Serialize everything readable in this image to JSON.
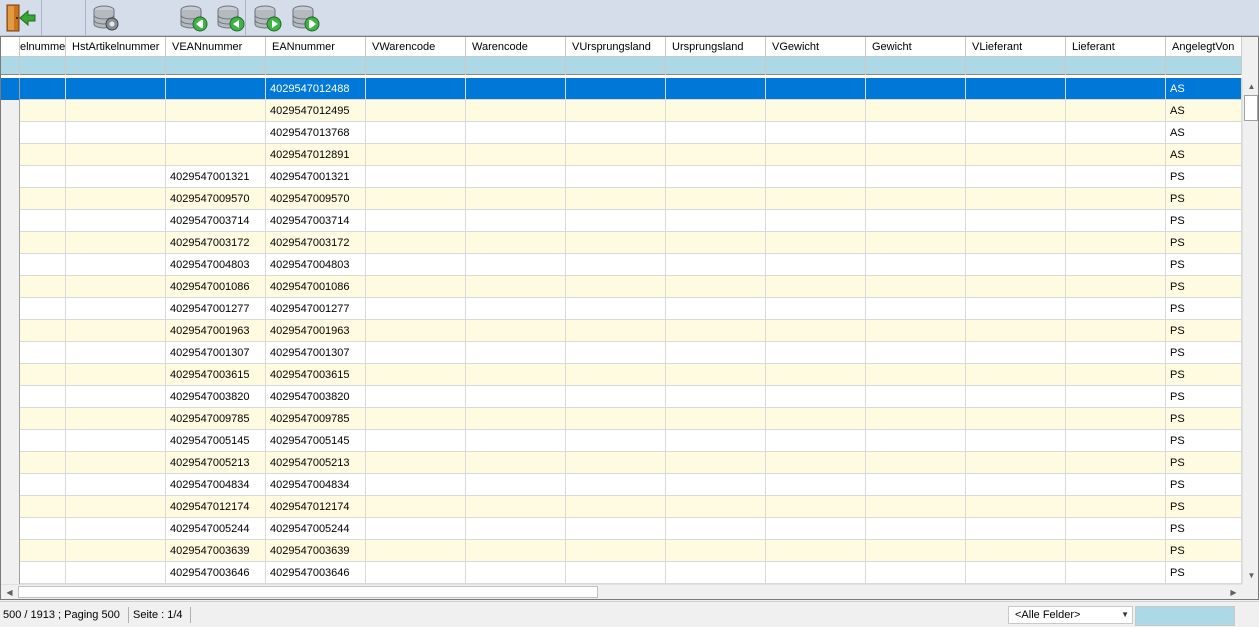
{
  "toolbar": {
    "buttons": [
      {
        "name": "exit-door-icon"
      },
      {
        "name": "database-settings-icon"
      },
      {
        "name": "database-first-icon"
      },
      {
        "name": "database-previous-icon"
      },
      {
        "name": "database-next-icon"
      },
      {
        "name": "database-last-icon"
      }
    ]
  },
  "grid": {
    "columns": [
      "elnummer",
      "HstArtikelnummer",
      "VEANnummer",
      "EANnummer",
      "VWarencode",
      "Warencode",
      "VUrsprungsland",
      "Ursprungsland",
      "VGewicht",
      "Gewicht",
      "VLieferant",
      "Lieferant",
      "AngelegtVon"
    ],
    "rows": [
      [
        "",
        "",
        "",
        "4029547012488",
        "",
        "",
        "",
        "",
        "",
        "",
        "",
        "",
        "AS"
      ],
      [
        "",
        "",
        "",
        "4029547012495",
        "",
        "",
        "",
        "",
        "",
        "",
        "",
        "",
        "AS"
      ],
      [
        "",
        "",
        "",
        "4029547013768",
        "",
        "",
        "",
        "",
        "",
        "",
        "",
        "",
        "AS"
      ],
      [
        "",
        "",
        "",
        "4029547012891",
        "",
        "",
        "",
        "",
        "",
        "",
        "",
        "",
        "AS"
      ],
      [
        "",
        "",
        "4029547001321",
        "4029547001321",
        "",
        "",
        "",
        "",
        "",
        "",
        "",
        "",
        "PS"
      ],
      [
        "",
        "",
        "4029547009570",
        "4029547009570",
        "",
        "",
        "",
        "",
        "",
        "",
        "",
        "",
        "PS"
      ],
      [
        "",
        "",
        "4029547003714",
        "4029547003714",
        "",
        "",
        "",
        "",
        "",
        "",
        "",
        "",
        "PS"
      ],
      [
        "",
        "",
        "4029547003172",
        "4029547003172",
        "",
        "",
        "",
        "",
        "",
        "",
        "",
        "",
        "PS"
      ],
      [
        "",
        "",
        "4029547004803",
        "4029547004803",
        "",
        "",
        "",
        "",
        "",
        "",
        "",
        "",
        "PS"
      ],
      [
        "",
        "",
        "4029547001086",
        "4029547001086",
        "",
        "",
        "",
        "",
        "",
        "",
        "",
        "",
        "PS"
      ],
      [
        "",
        "",
        "4029547001277",
        "4029547001277",
        "",
        "",
        "",
        "",
        "",
        "",
        "",
        "",
        "PS"
      ],
      [
        "",
        "",
        "4029547001963",
        "4029547001963",
        "",
        "",
        "",
        "",
        "",
        "",
        "",
        "",
        "PS"
      ],
      [
        "",
        "",
        "4029547001307",
        "4029547001307",
        "",
        "",
        "",
        "",
        "",
        "",
        "",
        "",
        "PS"
      ],
      [
        "",
        "",
        "4029547003615",
        "4029547003615",
        "",
        "",
        "",
        "",
        "",
        "",
        "",
        "",
        "PS"
      ],
      [
        "",
        "",
        "4029547003820",
        "4029547003820",
        "",
        "",
        "",
        "",
        "",
        "",
        "",
        "",
        "PS"
      ],
      [
        "",
        "",
        "4029547009785",
        "4029547009785",
        "",
        "",
        "",
        "",
        "",
        "",
        "",
        "",
        "PS"
      ],
      [
        "",
        "",
        "4029547005145",
        "4029547005145",
        "",
        "",
        "",
        "",
        "",
        "",
        "",
        "",
        "PS"
      ],
      [
        "",
        "",
        "4029547005213",
        "4029547005213",
        "",
        "",
        "",
        "",
        "",
        "",
        "",
        "",
        "PS"
      ],
      [
        "",
        "",
        "4029547004834",
        "4029547004834",
        "",
        "",
        "",
        "",
        "",
        "",
        "",
        "",
        "PS"
      ],
      [
        "",
        "",
        "4029547012174",
        "4029547012174",
        "",
        "",
        "",
        "",
        "",
        "",
        "",
        "",
        "PS"
      ],
      [
        "",
        "",
        "4029547005244",
        "4029547005244",
        "",
        "",
        "",
        "",
        "",
        "",
        "",
        "",
        "PS"
      ],
      [
        "",
        "",
        "4029547003639",
        "4029547003639",
        "",
        "",
        "",
        "",
        "",
        "",
        "",
        "",
        "PS"
      ],
      [
        "",
        "",
        "4029547003646",
        "4029547003646",
        "",
        "",
        "",
        "",
        "",
        "",
        "",
        "",
        "PS"
      ]
    ],
    "selected_row": 0
  },
  "status": {
    "records": "500 / 1913 ; Paging 500",
    "page": "Seite : 1/4",
    "fields_select": "<Alle Felder>",
    "search_value": ""
  },
  "colors": {
    "toolbar_bg": "#d4dde9",
    "selection": "#0078d7",
    "alt_row": "#fffbe1",
    "filter_row": "#add8e6"
  }
}
